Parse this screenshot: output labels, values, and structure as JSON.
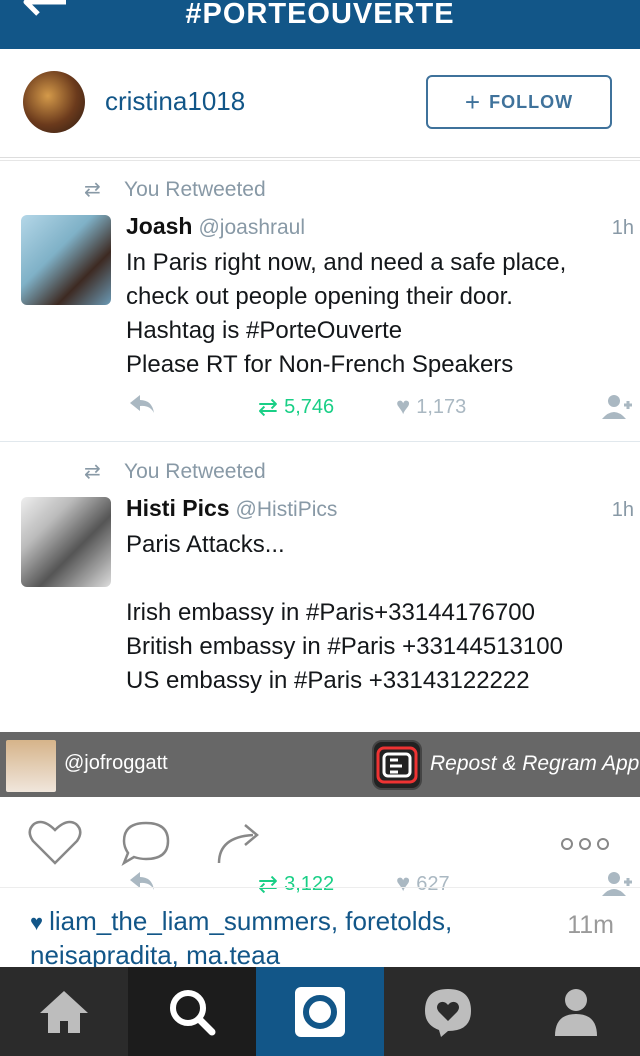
{
  "header": {
    "title": "#PORTEOUVERTE",
    "back_icon": "arrow-left-icon"
  },
  "user": {
    "username": "cristina1018",
    "follow_label": "FOLLOW"
  },
  "tweets": [
    {
      "retweet_label": "You Retweeted",
      "name": "Joash",
      "handle": "@joashraul",
      "time": "1h",
      "text": "In Paris right now, and need a safe place,\ncheck out people opening their door.\nHashtag is #PorteOuverte\nPlease RT for Non-French Speakers",
      "retweets": "5,746",
      "likes": "1,173"
    },
    {
      "retweet_label": "You Retweeted",
      "name": "Histi Pics",
      "handle": "@HistiPics",
      "time": "1h",
      "text": "Paris Attacks...\n\nIrish embassy in #Paris+33144176700\nBritish embassy in #Paris +33144513100\nUS embassy in #Paris  +33143122222",
      "retweets": "3,122",
      "likes": "627"
    }
  ],
  "overlay": {
    "user": "@jofroggatt",
    "app": "Repost & Regram App"
  },
  "post": {
    "likers": "liam_the_liam_summers, foretolds, neisapradita, ma.teaa",
    "time": "11m"
  },
  "colors": {
    "brand": "#125688",
    "retweet_green": "#19cf86",
    "muted": "#8899a6"
  }
}
